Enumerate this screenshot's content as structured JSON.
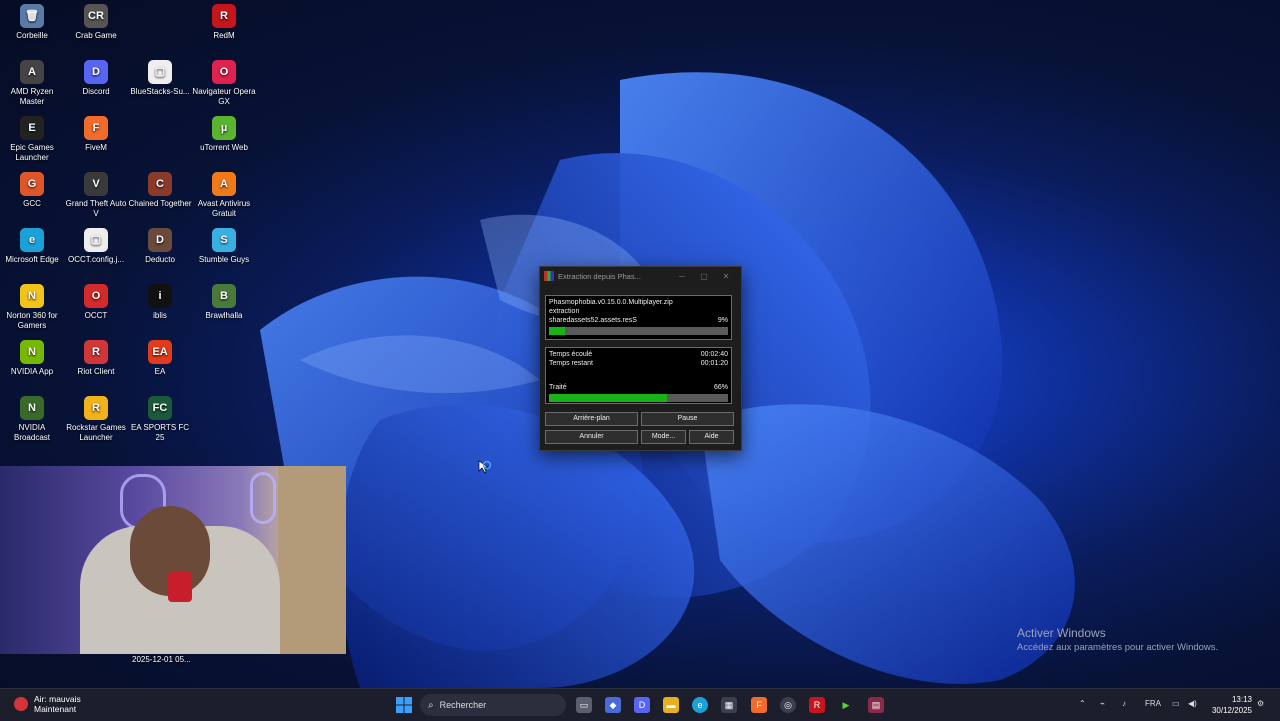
{
  "desktop_icons": [
    {
      "label": "Corbeille",
      "glyph": "🗑",
      "color": "#5a7aa8"
    },
    {
      "label": "Crab Game",
      "glyph": "CR",
      "color": "#555"
    },
    {
      "label": "RedM",
      "glyph": "R",
      "color": "#c4161c"
    },
    {
      "label": "AMD Ryzen Master",
      "glyph": "A",
      "color": "#444"
    },
    {
      "label": "Discord",
      "glyph": "D",
      "color": "#5865f2"
    },
    {
      "label": "BlueStacks-Su...",
      "glyph": "▢",
      "color": "#eee"
    },
    {
      "label": "Navigateur Opera GX",
      "glyph": "O",
      "color": "#e0224f"
    },
    {
      "label": "Epic Games Launcher",
      "glyph": "E",
      "color": "#222"
    },
    {
      "label": "FiveM",
      "glyph": "F",
      "color": "#f26b2a"
    },
    {
      "label": "uTorrent Web",
      "glyph": "µ",
      "color": "#5bb32f"
    },
    {
      "label": "GCC",
      "glyph": "G",
      "color": "#e0562a"
    },
    {
      "label": "Grand Theft Auto V",
      "glyph": "V",
      "color": "#3a3a3a"
    },
    {
      "label": "Chained Together",
      "glyph": "C",
      "color": "#8a3a2a"
    },
    {
      "label": "Avast Antivirus Gratuit",
      "glyph": "A",
      "color": "#f07a1a"
    },
    {
      "label": "Microsoft Edge",
      "glyph": "e",
      "color": "#1ba1d8"
    },
    {
      "label": "OCCT.config.j...",
      "glyph": "▢",
      "color": "#eee"
    },
    {
      "label": "Deducto",
      "glyph": "D",
      "color": "#6a4a3a"
    },
    {
      "label": "Stumble Guys",
      "glyph": "S",
      "color": "#3ab0e0"
    },
    {
      "label": "Norton 360 for Gamers",
      "glyph": "N",
      "color": "#f2c41a"
    },
    {
      "label": "OCCT",
      "glyph": "O",
      "color": "#d42a2a"
    },
    {
      "label": "iblis",
      "glyph": "i",
      "color": "#111"
    },
    {
      "label": "Brawlhalla",
      "glyph": "B",
      "color": "#4a7a3a"
    },
    {
      "label": "NVIDIA App",
      "glyph": "N",
      "color": "#76b900"
    },
    {
      "label": "Riot Client",
      "glyph": "R",
      "color": "#d13639"
    },
    {
      "label": "EA",
      "glyph": "EA",
      "color": "#e23a1a"
    },
    {
      "label": "NVIDIA Broadcast",
      "glyph": "N",
      "color": "#3a6a2a"
    },
    {
      "label": "Rockstar Games Launcher",
      "glyph": "R",
      "color": "#f2b21a"
    },
    {
      "label": "EA SPORTS FC 25",
      "glyph": "FC",
      "color": "#1a5a3a"
    }
  ],
  "dialog": {
    "title": "Extraction depuis Phas...",
    "archive": "Phasmophobia.v0.15.0.0.Multiplayer.zip",
    "action": "extraction",
    "current_file": "sharedassets52.assets.resS",
    "file_percent": "9%",
    "file_progress": 0.09,
    "elapsed_label": "Temps écoulé",
    "elapsed": "00:02:40",
    "remaining_label": "Temps restant",
    "remaining": "00:01:20",
    "processed_label": "Traité",
    "processed_percent": "66%",
    "processed_progress": 0.66,
    "buttons": {
      "background": "Arrière-plan",
      "pause": "Pause",
      "cancel": "Annuler",
      "mode": "Mode...",
      "help": "Aide"
    }
  },
  "webcam_timestamp": "2025-12-01 05...",
  "activation": {
    "line1": "Activer Windows",
    "line2": "Accédez aux paramètres pour activer Windows."
  },
  "taskbar": {
    "weather_title": "Air: mauvais",
    "weather_sub": "Maintenant",
    "search_placeholder": "Rechercher",
    "language": "FRA",
    "time": "13:13",
    "date": "30/12/2025"
  }
}
